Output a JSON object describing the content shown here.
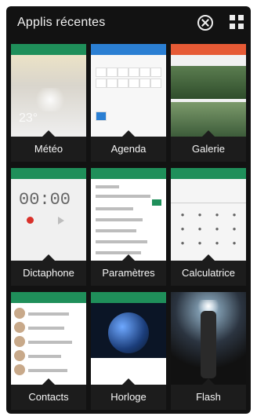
{
  "header": {
    "title": "Applis récentes",
    "close_icon": "close-circle-icon",
    "grid_icon": "grid-icon"
  },
  "apps": [
    {
      "label": "Météo",
      "icon": "weather-thumbnail",
      "accent": "#1f8f5a",
      "temp_text": "23°"
    },
    {
      "label": "Agenda",
      "icon": "calendar-thumbnail",
      "accent": "#2b7fd3"
    },
    {
      "label": "Galerie",
      "icon": "gallery-thumbnail",
      "accent": "#e65a35"
    },
    {
      "label": "Dictaphone",
      "icon": "recorder-thumbnail",
      "accent": "#1f8f5a",
      "time_text": "00:00"
    },
    {
      "label": "Paramètres",
      "icon": "settings-thumbnail",
      "accent": "#1f8f5a"
    },
    {
      "label": "Calculatrice",
      "icon": "calculator-thumbnail",
      "accent": "#1f8f5a"
    },
    {
      "label": "Contacts",
      "icon": "contacts-thumbnail",
      "accent": "#1f8f5a"
    },
    {
      "label": "Horloge",
      "icon": "clock-thumbnail",
      "accent": "#1f8f5a"
    },
    {
      "label": "Flash",
      "icon": "flashlight-thumbnail",
      "accent": "#9fc2d9"
    }
  ]
}
